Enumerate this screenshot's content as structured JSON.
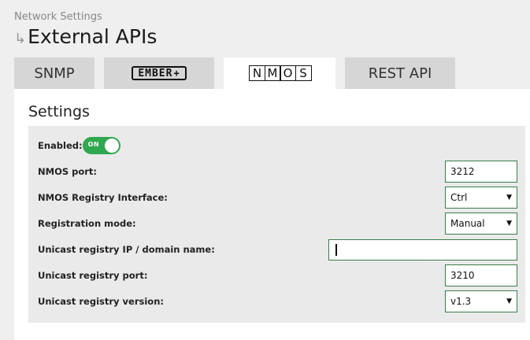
{
  "breadcrumb": "Network Settings",
  "page_title": "External APIs",
  "tabs": {
    "snmp": "SNMP",
    "ember_letters": "EMBER",
    "ember_plus": "+",
    "nmos_letters": [
      "N",
      "M",
      "O",
      "S"
    ],
    "rest": "REST API",
    "active": "NMOS"
  },
  "section_title": "Settings",
  "settings": {
    "enabled": {
      "label": "Enabled:",
      "toggle_text": "ON",
      "value": true
    },
    "nmos_port": {
      "label": "NMOS port:",
      "value": "3212"
    },
    "registry_interface": {
      "label": "NMOS Registry Interface:",
      "value": "Ctrl"
    },
    "registration_mode": {
      "label": "Registration mode:",
      "value": "Manual"
    },
    "unicast_ip": {
      "label": "Unicast registry IP / domain name:",
      "value": ""
    },
    "unicast_port": {
      "label": "Unicast registry port:",
      "value": "3210"
    },
    "unicast_version": {
      "label": "Unicast registry version:",
      "value": "v1.3"
    }
  },
  "colors": {
    "toggle_on": "#2fa84f",
    "input_border": "#3a7d4a"
  },
  "icons": {
    "title_arrow": "return-arrow-icon",
    "select_chevron": "chevron-down-icon"
  }
}
